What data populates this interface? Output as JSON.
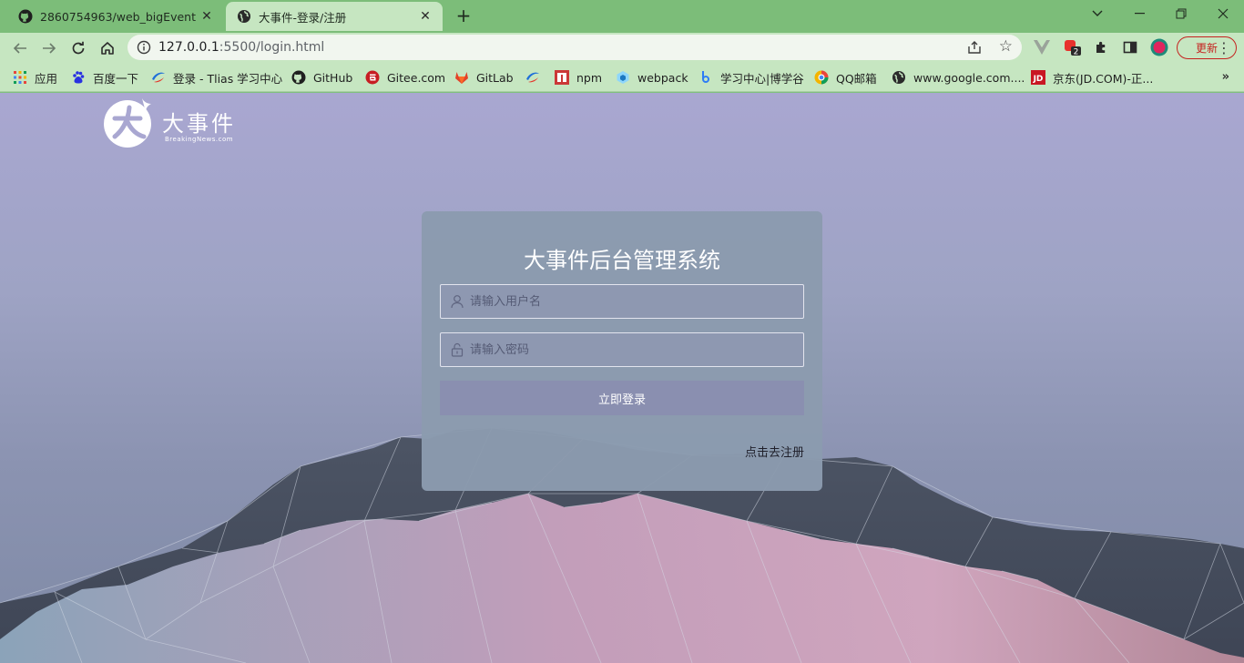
{
  "browser": {
    "tabs": [
      {
        "title": "2860754963/web_bigEvent",
        "favicon": "github-icon",
        "active": false
      },
      {
        "title": "大事件-登录/注册",
        "favicon": "globe-icon",
        "active": true
      }
    ],
    "new_tab_symbol": "+",
    "window_controls": {
      "dropdown": "⌄",
      "minimize": "—",
      "restore": "❐",
      "close": "✕"
    },
    "url": {
      "host": "127.0.0.1",
      "rest": ":5500/login.html"
    },
    "extension_badge": "2",
    "update_label": "更新",
    "menu_symbol": "⋮",
    "accent_color": "#c5221f"
  },
  "bookmarks": [
    {
      "label": "应用",
      "icon": "apps-grid-icon"
    },
    {
      "label": "百度一下",
      "icon": "baidu-icon"
    },
    {
      "label": "登录 - Tlias 学习中心",
      "icon": "tlias-icon"
    },
    {
      "label": "GitHub",
      "icon": "github-icon"
    },
    {
      "label": "Gitee.com",
      "icon": "gitee-icon"
    },
    {
      "label": "GitLab",
      "icon": "gitlab-icon"
    },
    {
      "label": "",
      "icon": "tlias-icon"
    },
    {
      "label": "npm",
      "icon": "npm-icon"
    },
    {
      "label": "webpack",
      "icon": "webpack-icon"
    },
    {
      "label": "学习中心|博学谷",
      "icon": "boxuegu-icon"
    },
    {
      "label": "QQ邮箱",
      "icon": "qqmail-icon"
    },
    {
      "label": "www.google.com....",
      "icon": "globe-icon"
    },
    {
      "label": "京东(JD.COM)-正...",
      "icon": "jd-icon"
    }
  ],
  "bookmarks_more": "»",
  "logo": {
    "title": "大事件",
    "subtitle": "BreakingNews.com"
  },
  "login": {
    "title": "大事件后台管理系统",
    "username_placeholder": "请输入用户名",
    "password_placeholder": "请输入密码",
    "submit_label": "立即登录",
    "register_link": "点击去注册"
  }
}
